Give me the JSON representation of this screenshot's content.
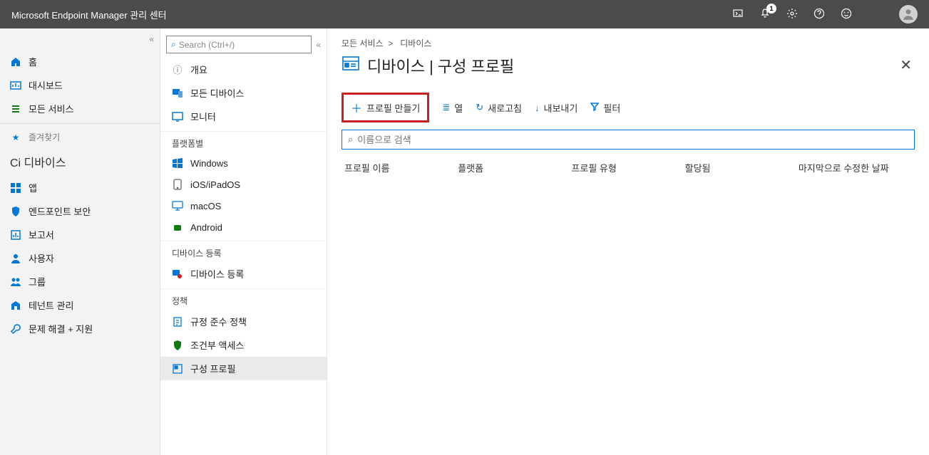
{
  "topbar": {
    "title": "Microsoft Endpoint Manager 관리 센터",
    "notification_count": "1"
  },
  "sidebar": {
    "home": "홈",
    "dashboard": "대시보드",
    "all_services": "모든 서비스",
    "favorites": "즐겨찾기",
    "ci_devices": "Ci 디바이스",
    "apps": "앱",
    "endpoint_security": "엔드포인트 보안",
    "reports": "보고서",
    "users": "사용자",
    "groups": "그룹",
    "tenant_admin": "테넌트 관리",
    "troubleshoot": "문제 해결 + 지원"
  },
  "subnav": {
    "search_placeholder": "Search (Ctrl+/)",
    "overview": "개요",
    "all_devices": "모든 디바이스",
    "monitor": "모니터",
    "group_platform": "플랫폼별",
    "windows": "Windows",
    "ios": "iOS/iPadOS",
    "macos": "macOS",
    "android": "Android",
    "group_enroll": "디바이스 등록",
    "device_enroll": "디바이스 등록",
    "group_policy": "정책",
    "compliance": "규정 준수 정책",
    "conditional": "조건부 액세스",
    "config_profiles": "구성 프로필"
  },
  "main": {
    "breadcrumb_all": "모든 서비스",
    "breadcrumb_sep": " >  ",
    "breadcrumb_devices": "디바이스",
    "title": "디바이스 | 구성 프로필",
    "tb_create": "프로필 만들기",
    "tb_columns": "열",
    "tb_refresh": "새로고침",
    "tb_export": "내보내기",
    "tb_filter": "필터",
    "filter_placeholder": "이름으로 검색",
    "col_name": "프로필 이름",
    "col_platform": "플랫폼",
    "col_type": "프로필 유형",
    "col_assigned": "할당됨",
    "col_modified": "마지막으로 수정한 날짜"
  }
}
